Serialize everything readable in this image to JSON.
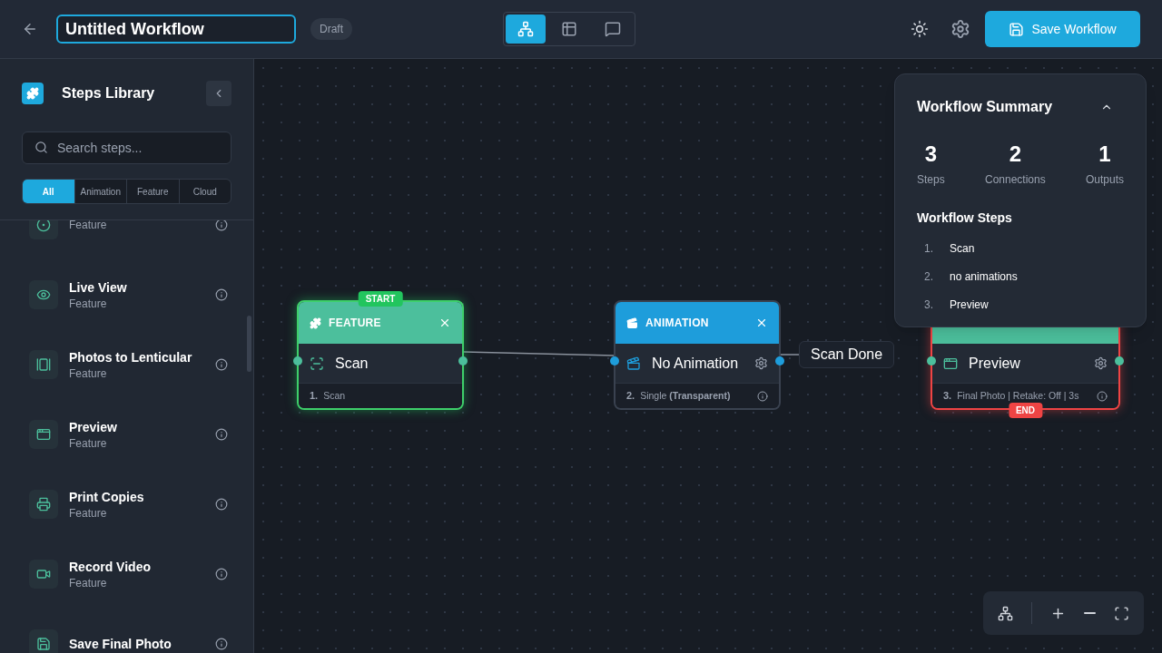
{
  "header": {
    "title": "Untitled Workflow",
    "status": "Draft",
    "view_tabs": [
      {
        "kind": "diagram",
        "selected": true
      },
      {
        "kind": "table",
        "selected": false
      },
      {
        "kind": "chat",
        "selected": false
      }
    ],
    "save_button": "Save Workflow"
  },
  "sidebar": {
    "title": "Steps Library",
    "search": {
      "placeholder": "Search steps..."
    },
    "filters": [
      {
        "label": "All",
        "selected": true
      },
      {
        "label": "Animation",
        "selected": false
      },
      {
        "label": "Feature",
        "selected": false
      },
      {
        "label": "Cloud",
        "selected": false
      }
    ],
    "items": [
      {
        "kind": "record",
        "category": "Feature"
      },
      {
        "kind": "eye",
        "name": "Live View",
        "category": "Feature"
      },
      {
        "kind": "lenticular",
        "name": "Photos to Lenticular",
        "category": "Feature"
      },
      {
        "kind": "preview",
        "name": "Preview",
        "category": "Feature"
      },
      {
        "kind": "print",
        "name": "Print Copies",
        "category": "Feature"
      },
      {
        "kind": "video",
        "name": "Record Video",
        "category": "Feature"
      },
      {
        "kind": "save",
        "name": "Save Final Photo"
      }
    ]
  },
  "canvas": {
    "nodes": [
      {
        "kind": "feature",
        "type": "FEATURE",
        "name": "Scan",
        "number": "1.",
        "footer": "Scan",
        "badge": "START"
      },
      {
        "kind": "animation",
        "type": "ANIMATION",
        "name": "No Animation",
        "number": "2.",
        "footer": "Single **(Transparent)**"
      },
      {
        "kind": "output",
        "name": "Preview",
        "number": "3.",
        "footer": "Final Photo | Retake: Off | 3s",
        "badge": "END"
      }
    ],
    "edge_label": "Scan Done"
  },
  "summary": {
    "title": "Workflow Summary",
    "expanded": true,
    "stats": [
      {
        "value": "3",
        "label": "Steps"
      },
      {
        "value": "2",
        "label": "Connections"
      },
      {
        "value": "1",
        "label": "Outputs"
      }
    ],
    "steps_title": "Workflow Steps",
    "steps": [
      {
        "number": "1.",
        "name": "Scan"
      },
      {
        "number": "2.",
        "name": "no animations"
      },
      {
        "number": "3.",
        "name": "Preview"
      }
    ]
  }
}
